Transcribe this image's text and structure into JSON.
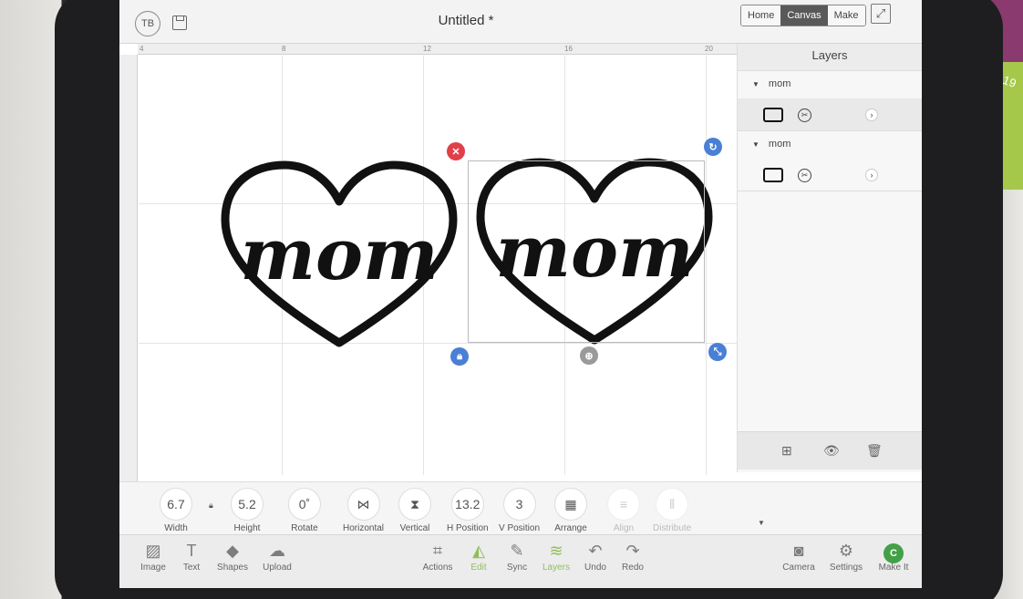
{
  "window": {
    "title": "Untitled *"
  },
  "header": {
    "avatar_initials": "TB",
    "modes": [
      {
        "label": "Home",
        "active": false
      },
      {
        "label": "Canvas",
        "active": true
      },
      {
        "label": "Make",
        "active": false
      }
    ]
  },
  "rulers": {
    "top": [
      "4",
      "8",
      "12",
      "16",
      "20"
    ]
  },
  "canvas": {
    "designs": [
      "mom",
      "mom"
    ],
    "selection_index": 1
  },
  "layers": {
    "title": "Layers",
    "groups": [
      {
        "name": "mom",
        "selected": true
      },
      {
        "name": "mom",
        "selected": false
      }
    ]
  },
  "editbar": {
    "width": {
      "value": "6.7",
      "label": "Width"
    },
    "height": {
      "value": "5.2",
      "label": "Height"
    },
    "rotate": {
      "value": "0˚",
      "label": "Rotate"
    },
    "horizontal": {
      "label": "Horizontal"
    },
    "vertical": {
      "label": "Vertical"
    },
    "hpos": {
      "value": "13.2",
      "label": "H Position"
    },
    "vpos": {
      "value": "3",
      "label": "V Position"
    },
    "arrange": {
      "label": "Arrange"
    },
    "align": {
      "label": "Align"
    },
    "distribute": {
      "label": "Distribute"
    }
  },
  "toolbar": {
    "left": [
      "Image",
      "Text",
      "Shapes",
      "Upload"
    ],
    "center": [
      {
        "label": "Actions",
        "icon": "actions-icon"
      },
      {
        "label": "Edit",
        "icon": "edit-icon",
        "active": true
      },
      {
        "label": "Sync",
        "icon": "sync-icon"
      },
      {
        "label": "Layers",
        "icon": "layers-icon",
        "active": true
      },
      {
        "label": "Undo",
        "icon": "undo-icon"
      },
      {
        "label": "Redo",
        "icon": "redo-icon"
      }
    ],
    "right": [
      "Camera",
      "Settings",
      "Make It"
    ],
    "make_it_initial": "C"
  },
  "colors": {
    "handle_blue": "#4a7fd6",
    "delete_red": "#e0404a",
    "active_green": "#8fbf5a",
    "mode_active": "#595959"
  }
}
